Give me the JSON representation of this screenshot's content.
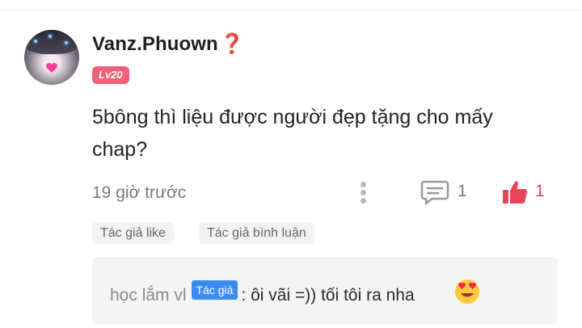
{
  "comment": {
    "username": "Vanz.Phuown",
    "username_mark": "❓",
    "level": "Lv20",
    "text": "5bông thì liệu được người đẹp tặng cho mấy chap?",
    "time": "19 giờ trước",
    "reply_count": "1",
    "like_count": "1",
    "tags": [
      "Tác giả like",
      "Tác giả bình luận"
    ],
    "reply": {
      "author": "học lắm vl",
      "badge": "Tác giả",
      "text": ": ôi vãi =)) tối tôi ra nha"
    }
  },
  "colors": {
    "level_badge": "#f2607a",
    "like": "#e8445a",
    "author_badge": "#3a8cf0",
    "question_mark": "#e02424"
  },
  "icons": {
    "more": "vertical-dots-icon",
    "reply": "comment-bubble-icon",
    "like": "thumbs-up-icon",
    "emoji": "heart-eyes-emoji-icon"
  }
}
